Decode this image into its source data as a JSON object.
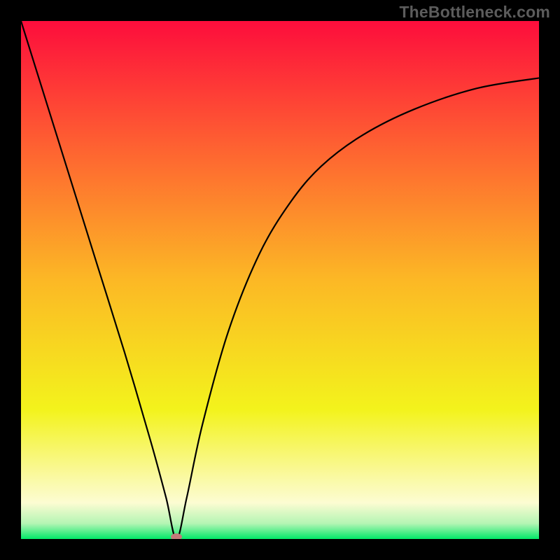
{
  "watermark": "TheBottleneck.com",
  "chart_data": {
    "type": "line",
    "title": "",
    "xlabel": "",
    "ylabel": "",
    "xlim": [
      0,
      100
    ],
    "ylim": [
      0,
      100
    ],
    "grid": false,
    "legend": false,
    "series": [
      {
        "name": "curve",
        "x": [
          0,
          5,
          10,
          15,
          20,
          25,
          28,
          30,
          32,
          35,
          40,
          46,
          52,
          58,
          66,
          76,
          88,
          100
        ],
        "y": [
          100,
          84,
          68,
          52,
          36,
          19,
          8,
          0,
          8,
          22,
          40,
          55,
          65,
          72,
          78,
          83,
          87,
          89
        ]
      }
    ],
    "minimum_marker": {
      "x": 30,
      "y": 0
    },
    "background_gradient": {
      "stops": [
        {
          "offset": 0.0,
          "color": "#fd0d3c"
        },
        {
          "offset": 0.25,
          "color": "#fe6431"
        },
        {
          "offset": 0.5,
          "color": "#fcb825"
        },
        {
          "offset": 0.75,
          "color": "#f3f31c"
        },
        {
          "offset": 0.88,
          "color": "#faf9a1"
        },
        {
          "offset": 0.93,
          "color": "#fcfcd2"
        },
        {
          "offset": 0.97,
          "color": "#b4f5b4"
        },
        {
          "offset": 1.0,
          "color": "#01e968"
        }
      ]
    },
    "colors": {
      "line": "#000000",
      "marker": "#c47a7a",
      "frame": "#000000"
    }
  }
}
